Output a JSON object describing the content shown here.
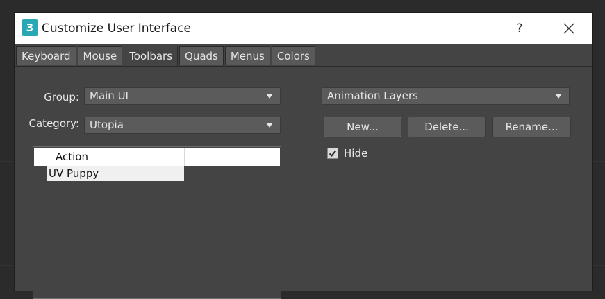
{
  "window": {
    "title": "Customize User Interface",
    "app_icon_text": "3",
    "help_label": "?",
    "close_icon": "close-icon"
  },
  "tabs": [
    {
      "label": "Keyboard",
      "active": false
    },
    {
      "label": "Mouse",
      "active": false
    },
    {
      "label": "Toolbars",
      "active": true
    },
    {
      "label": "Quads",
      "active": false
    },
    {
      "label": "Menus",
      "active": false
    },
    {
      "label": "Colors",
      "active": false
    }
  ],
  "left_panel": {
    "group_label": "Group:",
    "group_value": "Main UI",
    "category_label": "Category:",
    "category_value": "Utopia",
    "list": {
      "column_header": "Action",
      "rows": [
        "UV Puppy"
      ]
    }
  },
  "right_panel": {
    "toolbar_select_value": "Animation Layers",
    "buttons": {
      "new": "New...",
      "delete": "Delete...",
      "rename": "Rename..."
    },
    "hide_label": "Hide",
    "hide_checked": true
  },
  "colors": {
    "dialog_bg": "#444444",
    "control_bg": "#5b5b5b",
    "titlebar_bg": "#ffffff",
    "app_icon": "#2aa7b5"
  }
}
